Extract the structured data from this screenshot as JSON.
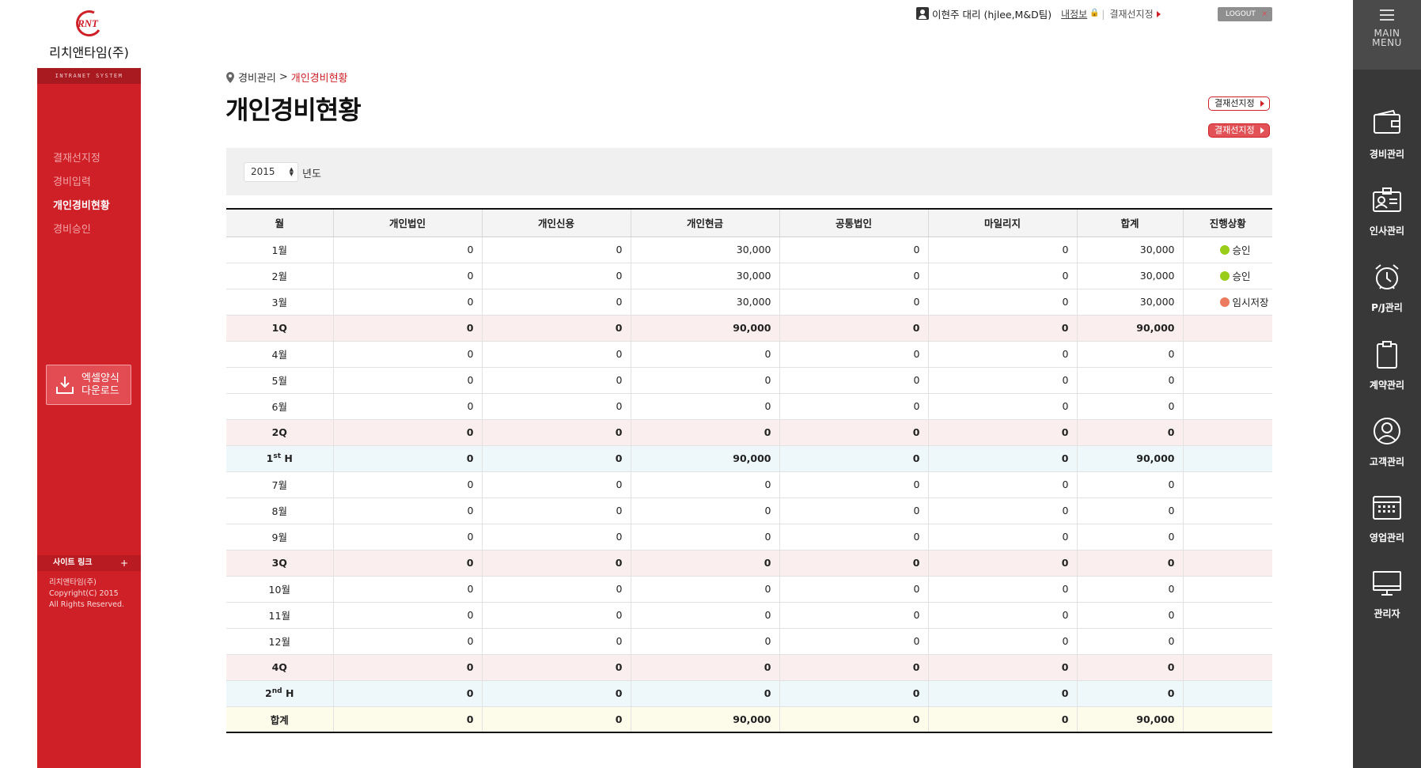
{
  "company": {
    "name": "리치앤타임(주)",
    "logo_text": "RNT",
    "tagline": "INTRANET SYSTEM"
  },
  "sidebar": {
    "items": [
      {
        "label": "결재선지정",
        "active": false
      },
      {
        "label": "경비입력",
        "active": false
      },
      {
        "label": "개인경비현황",
        "active": true
      },
      {
        "label": "경비승인",
        "active": false
      }
    ],
    "excel_button": {
      "line1": "엑셀양식",
      "line2": "다운로드"
    },
    "site_link": "사이트 링크",
    "site_link_plus": "+",
    "copyright": [
      "리치앤타임(주)",
      "Copyright(C) 2015",
      "All Rights Reserved."
    ]
  },
  "userbar": {
    "user": "이현주 대리 (hjlee,M&D팀)",
    "myinfo": "내정보",
    "approval_link": "결재선지정",
    "logout": "LOGOUT",
    "logout_x": "×"
  },
  "rightmenu": {
    "head": [
      "MAIN",
      "MENU"
    ],
    "items": [
      {
        "label": "경비관리",
        "icon": "wallet-icon"
      },
      {
        "label": "인사관리",
        "icon": "id-card-icon"
      },
      {
        "label": "P/J관리",
        "icon": "alarm-clock-icon"
      },
      {
        "label": "계약관리",
        "icon": "clipboard-icon"
      },
      {
        "label": "고객관리",
        "icon": "person-circle-icon"
      },
      {
        "label": "영업관리",
        "icon": "calendar-icon"
      },
      {
        "label": "관리자",
        "icon": "monitor-icon"
      }
    ]
  },
  "page": {
    "breadcrumb": {
      "parent": "경비관리",
      "arrow": ">",
      "current": "개인경비현황"
    },
    "title": "개인경비현황",
    "btn_approval_1": "결재선지정",
    "btn_approval_2": "결재선지정",
    "year": "2015",
    "year_label": "년도"
  },
  "colors": {
    "accent": "#cf2027",
    "approved": "#9acd1a",
    "temp": "#ec7a5c"
  },
  "table": {
    "headers": [
      "월",
      "개인법인",
      "개인신용",
      "개인현금",
      "공통법인",
      "마일리지",
      "합계",
      "진행상황"
    ],
    "rows": [
      {
        "type": "m",
        "label": "1월",
        "v": [
          "0",
          "0",
          "30,000",
          "0",
          "0",
          "30,000"
        ],
        "status": "승인",
        "status_color": "#9acd1a"
      },
      {
        "type": "m",
        "label": "2월",
        "v": [
          "0",
          "0",
          "30,000",
          "0",
          "0",
          "30,000"
        ],
        "status": "승인",
        "status_color": "#9acd1a"
      },
      {
        "type": "m",
        "label": "3월",
        "v": [
          "0",
          "0",
          "30,000",
          "0",
          "0",
          "30,000"
        ],
        "status": "임시저장",
        "status_color": "#ec7a5c"
      },
      {
        "type": "q",
        "label": "1Q",
        "v": [
          "0",
          "0",
          "90,000",
          "0",
          "0",
          "90,000"
        ],
        "status": ""
      },
      {
        "type": "m",
        "label": "4월",
        "v": [
          "0",
          "0",
          "0",
          "0",
          "0",
          "0"
        ],
        "status": ""
      },
      {
        "type": "m",
        "label": "5월",
        "v": [
          "0",
          "0",
          "0",
          "0",
          "0",
          "0"
        ],
        "status": ""
      },
      {
        "type": "m",
        "label": "6월",
        "v": [
          "0",
          "0",
          "0",
          "0",
          "0",
          "0"
        ],
        "status": ""
      },
      {
        "type": "q",
        "label": "2Q",
        "v": [
          "0",
          "0",
          "0",
          "0",
          "0",
          "0"
        ],
        "status": ""
      },
      {
        "type": "h",
        "label": "1",
        "sup": "st",
        "suffix": " H",
        "v": [
          "0",
          "0",
          "90,000",
          "0",
          "0",
          "90,000"
        ],
        "status": ""
      },
      {
        "type": "m",
        "label": "7월",
        "v": [
          "0",
          "0",
          "0",
          "0",
          "0",
          "0"
        ],
        "status": ""
      },
      {
        "type": "m",
        "label": "8월",
        "v": [
          "0",
          "0",
          "0",
          "0",
          "0",
          "0"
        ],
        "status": ""
      },
      {
        "type": "m",
        "label": "9월",
        "v": [
          "0",
          "0",
          "0",
          "0",
          "0",
          "0"
        ],
        "status": ""
      },
      {
        "type": "q",
        "label": "3Q",
        "v": [
          "0",
          "0",
          "0",
          "0",
          "0",
          "0"
        ],
        "status": ""
      },
      {
        "type": "m",
        "label": "10월",
        "v": [
          "0",
          "0",
          "0",
          "0",
          "0",
          "0"
        ],
        "status": ""
      },
      {
        "type": "m",
        "label": "11월",
        "v": [
          "0",
          "0",
          "0",
          "0",
          "0",
          "0"
        ],
        "status": ""
      },
      {
        "type": "m",
        "label": "12월",
        "v": [
          "0",
          "0",
          "0",
          "0",
          "0",
          "0"
        ],
        "status": ""
      },
      {
        "type": "q",
        "label": "4Q",
        "v": [
          "0",
          "0",
          "0",
          "0",
          "0",
          "0"
        ],
        "status": ""
      },
      {
        "type": "h",
        "label": "2",
        "sup": "nd",
        "suffix": " H",
        "v": [
          "0",
          "0",
          "0",
          "0",
          "0",
          "0"
        ],
        "status": ""
      },
      {
        "type": "total",
        "label": "합계",
        "v": [
          "0",
          "0",
          "90,000",
          "0",
          "0",
          "90,000"
        ],
        "status": ""
      }
    ]
  }
}
